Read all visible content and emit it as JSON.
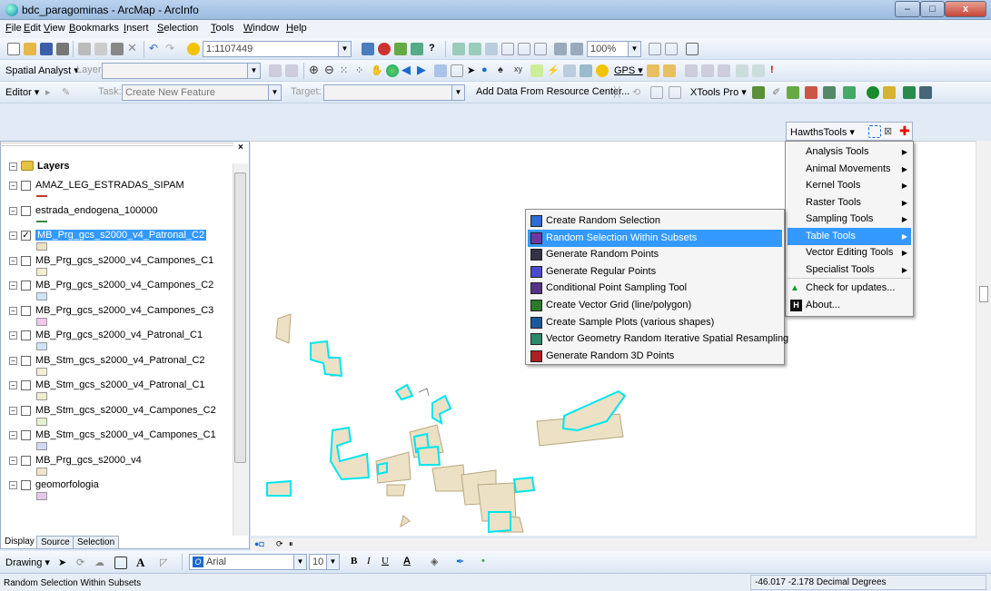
{
  "window": {
    "title": "bdc_paragominas - ArcMap - ArcInfo",
    "min": "–",
    "max": "□",
    "close": "x"
  },
  "menubar": [
    {
      "pre": "",
      "u": "F",
      "post": "ile"
    },
    {
      "pre": "",
      "u": "E",
      "post": "dit"
    },
    {
      "pre": "",
      "u": "V",
      "post": "iew"
    },
    {
      "pre": "",
      "u": "B",
      "post": "ookmarks"
    },
    {
      "pre": "",
      "u": "I",
      "post": "nsert"
    },
    {
      "pre": "",
      "u": "S",
      "post": "election"
    },
    {
      "pre": "",
      "u": "T",
      "post": "ools"
    },
    {
      "pre": "",
      "u": "W",
      "post": "indow"
    },
    {
      "pre": "",
      "u": "H",
      "post": "elp"
    }
  ],
  "toolbar1": {
    "scale": "1:1107449",
    "zoom": "100%"
  },
  "toolbar2": {
    "spatial_analyst": "Spatial Analyst ▾",
    "layer_label": "Layer:",
    "gps": "GPS ▾"
  },
  "toolbar3": {
    "editor": "Editor ▾",
    "task_label": "Task:",
    "task_value": "Create New Feature",
    "target_label": "Target:",
    "add_data": "Add Data From Resource Center...",
    "xtools": "XTools Pro ▾"
  },
  "hawths": {
    "label": "HawthsTools ▾"
  },
  "toc": {
    "root": "Layers",
    "layers": [
      {
        "name": "AMAZ_LEG_ESTRADAS_SIPAM",
        "checked": false,
        "sym": "line",
        "color": "#c0392b"
      },
      {
        "name": "estrada_endogena_100000",
        "checked": false,
        "sym": "line",
        "color": "#3a8a3a"
      },
      {
        "name": "MB_Prg_gcs_s2000_v4_Patronal_C2",
        "checked": true,
        "sym": "poly",
        "color": "#ece1c5",
        "selected": true
      },
      {
        "name": "MB_Prg_gcs_s2000_v4_Campones_C1",
        "checked": false,
        "sym": "poly",
        "color": "#f2eed2"
      },
      {
        "name": "MB_Prg_gcs_s2000_v4_Campones_C2",
        "checked": false,
        "sym": "poly",
        "color": "#cfe4f6"
      },
      {
        "name": "MB_Prg_gcs_s2000_v4_Campones_C3",
        "checked": false,
        "sym": "poly",
        "color": "#f2c8ee"
      },
      {
        "name": "MB_Prg_gcs_s2000_v4_Patronal_C1",
        "checked": false,
        "sym": "poly",
        "color": "#cfe4f6"
      },
      {
        "name": "MB_Stm_gcs_s2000_v4_Patronal_C2",
        "checked": false,
        "sym": "poly",
        "color": "#f5eed2"
      },
      {
        "name": "MB_Stm_gcs_s2000_v4_Patronal_C1",
        "checked": false,
        "sym": "poly",
        "color": "#f2edcf"
      },
      {
        "name": "MB_Stm_gcs_s2000_v4_Campones_C2",
        "checked": false,
        "sym": "poly",
        "color": "#e4f2cf"
      },
      {
        "name": "MB_Stm_gcs_s2000_v4_Campones_C1",
        "checked": false,
        "sym": "poly",
        "color": "#d0d8f5"
      },
      {
        "name": "MB_Prg_gcs_s2000_v4",
        "checked": false,
        "sym": "poly",
        "color": "#efe7c9"
      },
      {
        "name": "geomorfologia",
        "checked": false,
        "sym": "poly",
        "color": "#e7c8ec"
      }
    ],
    "tabs": [
      "Display",
      "Source",
      "Selection"
    ]
  },
  "hawths_menu": [
    {
      "label": "Analysis Tools",
      "sub": true
    },
    {
      "label": "Animal Movements",
      "sub": true
    },
    {
      "label": "Kernel Tools",
      "sub": true
    },
    {
      "label": "Raster Tools",
      "sub": true
    },
    {
      "label": "Sampling Tools",
      "sub": true
    },
    {
      "label": "Table Tools",
      "sub": true,
      "selected": true
    },
    {
      "label": "Vector Editing Tools",
      "sub": true
    },
    {
      "label": "Specialist Tools",
      "sub": true
    },
    {
      "label": "Check for updates...",
      "sub": false,
      "icon": "update-arrow-icon"
    },
    {
      "label": "About...",
      "sub": false,
      "icon": "hawths-logo-icon"
    }
  ],
  "table_menu": [
    {
      "label": "Create Random Selection",
      "icon": "random-selection-icon"
    },
    {
      "label": "Random Selection Within Subsets",
      "icon": "random-subsets-icon",
      "selected": true
    },
    {
      "label": "Generate Random Points",
      "icon": "random-points-icon"
    },
    {
      "label": "Generate Regular Points",
      "icon": "regular-points-icon"
    },
    {
      "label": "Conditional Point Sampling Tool",
      "icon": "conditional-sampling-icon"
    },
    {
      "label": "Create Vector Grid (line/polygon)",
      "icon": "vector-grid-icon"
    },
    {
      "label": "Create Sample Plots (various shapes)",
      "icon": "sample-plots-icon"
    },
    {
      "label": "Vector Geometry Random Iterative Spatial Resampling",
      "icon": "resampling-icon"
    },
    {
      "label": "Generate Random 3D Points",
      "icon": "random-3d-points-icon"
    }
  ],
  "drawing": {
    "label": "Drawing ▾",
    "font": "Arial",
    "size": "10"
  },
  "status": {
    "message": "Random Selection Within Subsets",
    "coords": "-46.017  -2.178 Decimal Degrees"
  },
  "colors": {
    "selection": "#3399ff",
    "feature_fill": "#ece1c5",
    "feature_outline": "#00e5ee"
  }
}
